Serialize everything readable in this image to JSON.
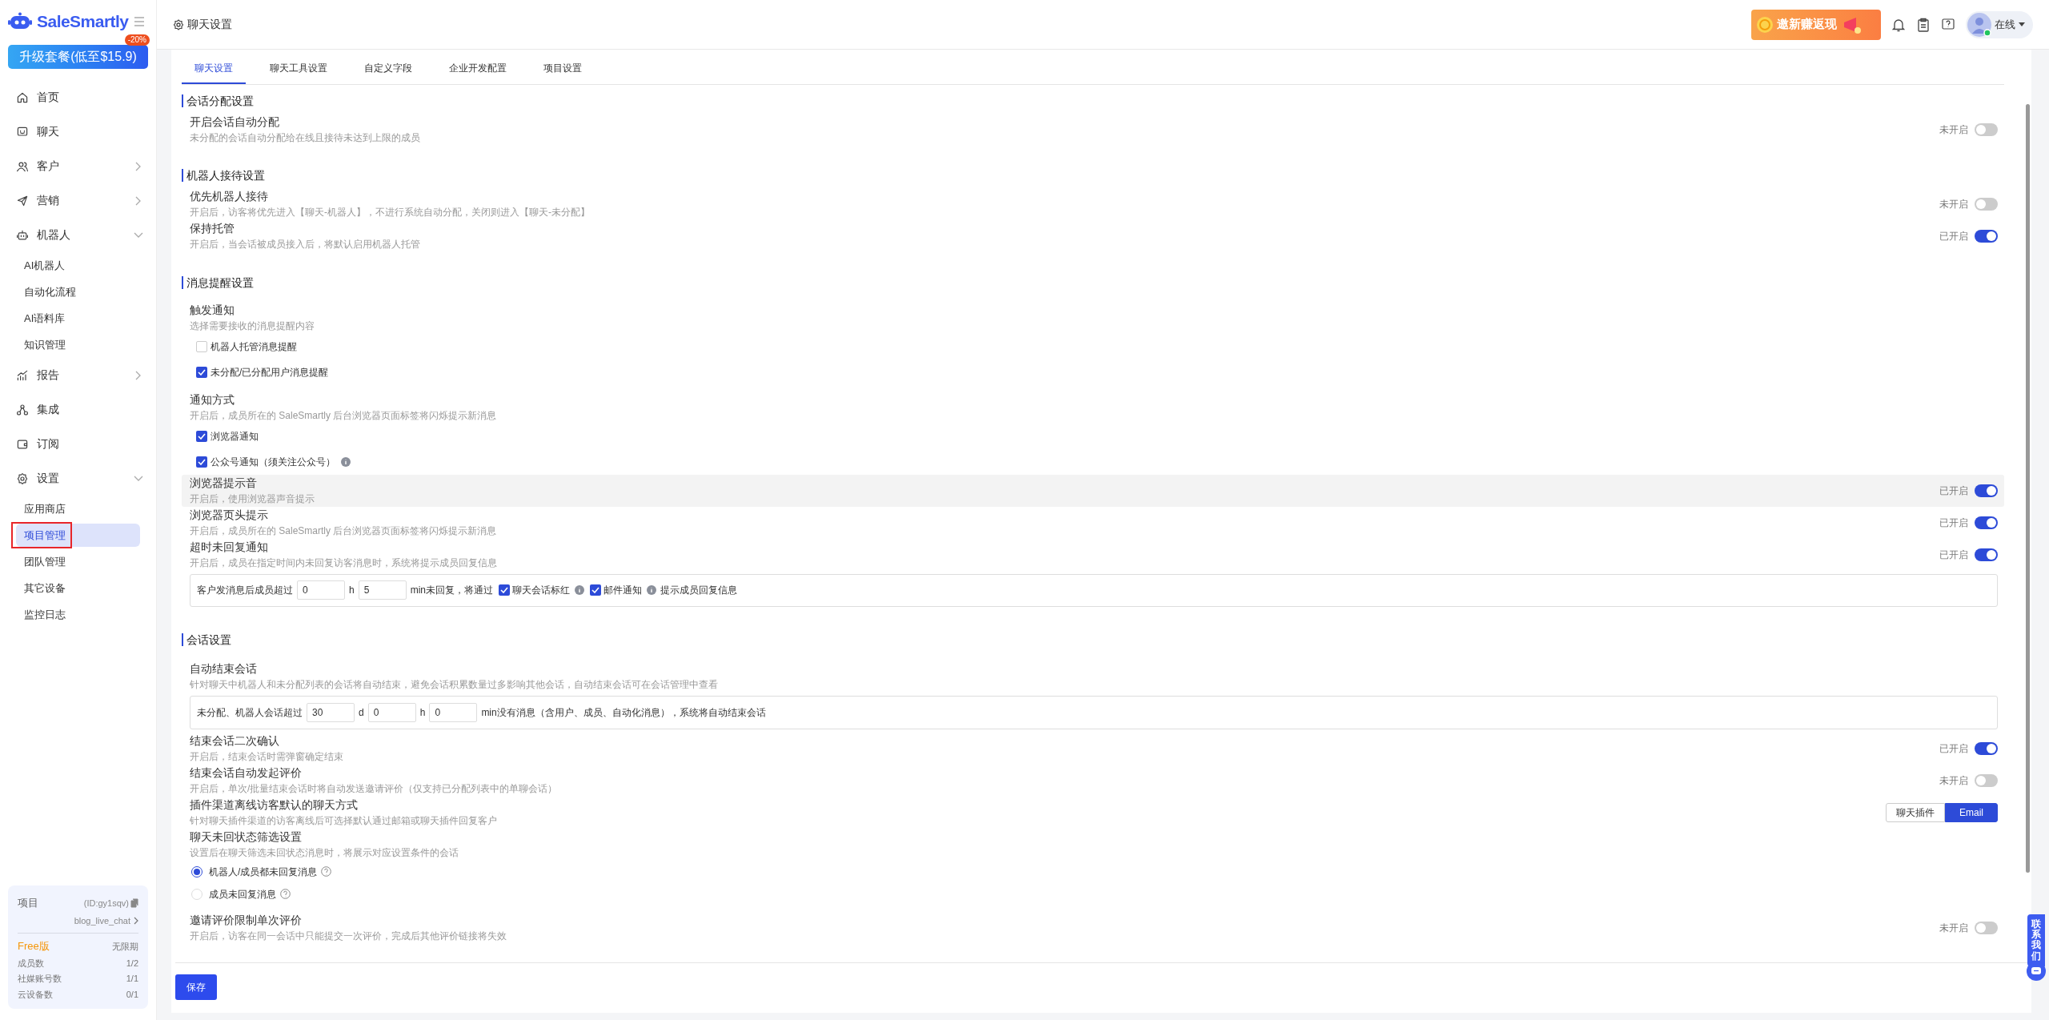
{
  "sidebar": {
    "logo": "SaleSmartly",
    "upgrade": {
      "label": "升级套餐(低至$15.9)",
      "badge": "-20%"
    },
    "items": [
      {
        "label": "首页"
      },
      {
        "label": "聊天"
      },
      {
        "label": "客户",
        "expanded": false
      },
      {
        "label": "营销",
        "expanded": false
      },
      {
        "label": "机器人",
        "expanded": true,
        "children": [
          {
            "label": "AI机器人",
            "selected": false,
            "annotated": false
          },
          {
            "label": "自动化流程",
            "selected": false,
            "annotated": false
          },
          {
            "label": "AI语料库",
            "selected": false,
            "annotated": false
          },
          {
            "label": "知识管理",
            "selected": false,
            "annotated": false
          }
        ]
      },
      {
        "label": "报告",
        "expanded": false
      },
      {
        "label": "集成"
      },
      {
        "label": "订阅"
      },
      {
        "label": "设置",
        "expanded": true,
        "children": [
          {
            "label": "应用商店",
            "selected": false,
            "annotated": false
          },
          {
            "label": "项目管理",
            "selected": true,
            "annotated": true
          },
          {
            "label": "团队管理",
            "selected": false,
            "annotated": false
          },
          {
            "label": "其它设备",
            "selected": false,
            "annotated": false
          },
          {
            "label": "监控日志",
            "selected": false,
            "annotated": false
          }
        ]
      }
    ],
    "project": {
      "label": "项目",
      "id": "(ID:gy1sqv)",
      "name": "blog_live_chat",
      "plan": "Free版",
      "term": "无限期",
      "stats": [
        {
          "label": "成员数",
          "value": "1/2"
        },
        {
          "label": "社媒账号数",
          "value": "1/1"
        },
        {
          "label": "云设备数",
          "value": "0/1"
        }
      ]
    }
  },
  "header": {
    "title": "聊天设置",
    "promo": "邀新赚返现",
    "status": "在线"
  },
  "tabs": [
    {
      "label": "聊天设置",
      "selected": true
    },
    {
      "label": "聊天工具设置",
      "selected": false
    },
    {
      "label": "自定义字段",
      "selected": false
    },
    {
      "label": "企业开发配置",
      "selected": false
    },
    {
      "label": "项目设置",
      "selected": false
    }
  ],
  "sections": [
    {
      "title": "会话分配设置",
      "settings": [
        {
          "kind": "toggle",
          "title": "开启会话自动分配",
          "desc": "未分配的会话自动分配给在线且接待未达到上限的成员",
          "on": false,
          "state_label": "未开启",
          "highlighted": false
        }
      ]
    },
    {
      "title": "机器人接待设置",
      "settings": [
        {
          "kind": "toggle",
          "title": "优先机器人接待",
          "desc": "开启后，访客将优先进入【聊天-机器人】，不进行系统自动分配，关闭则进入【聊天-未分配】",
          "on": false,
          "state_label": "未开启",
          "highlighted": false
        },
        {
          "kind": "toggle",
          "title": "保持托管",
          "desc": "开启后，当会话被成员接入后，将默认启用机器人托管",
          "on": true,
          "state_label": "已开启",
          "highlighted": false
        }
      ]
    },
    {
      "title": "消息提醒设置",
      "settings": [
        {
          "kind": "checks",
          "title": "触发通知",
          "desc": "选择需要接收的消息提醒内容",
          "options": [
            {
              "label": "机器人托管消息提醒",
              "checked": false,
              "info": false
            },
            {
              "label": "未分配/已分配用户消息提醒",
              "checked": true,
              "info": false
            }
          ]
        },
        {
          "kind": "checks",
          "title": "通知方式",
          "desc": "开启后，成员所在的 SaleSmartly 后台浏览器页面标签将闪烁提示新消息",
          "options": [
            {
              "label": "浏览器通知",
              "checked": true,
              "info": false
            },
            {
              "label": "公众号通知（须关注公众号）",
              "checked": true,
              "info": true
            }
          ]
        },
        {
          "kind": "toggle",
          "title": "浏览器提示音",
          "desc": "开启后，使用浏览器声音提示",
          "on": true,
          "state_label": "已开启",
          "highlighted": true
        },
        {
          "kind": "toggle",
          "title": "浏览器页头提示",
          "desc": "开启后，成员所在的 SaleSmartly 后台浏览器页面标签将闪烁提示新消息",
          "on": true,
          "state_label": "已开启",
          "highlighted": false
        },
        {
          "kind": "toggle",
          "title": "超时未回复通知",
          "desc": "开启后，成员在指定时间内未回复访客消息时，系统将提示成员回复信息",
          "on": true,
          "state_label": "已开启",
          "highlighted": false
        },
        {
          "kind": "form",
          "parts": [
            {
              "kind": "text",
              "text": "客户发消息后成员超过"
            },
            {
              "kind": "input",
              "value": "0"
            },
            {
              "kind": "text",
              "text": "h"
            },
            {
              "kind": "input",
              "value": "5"
            },
            {
              "kind": "text",
              "text": "min未回复，将通过"
            },
            {
              "kind": "check",
              "label": "聊天会话标红",
              "checked": true,
              "info": true
            },
            {
              "kind": "check",
              "label": "邮件通知",
              "checked": true,
              "info": true
            },
            {
              "kind": "text",
              "text": "提示成员回复信息"
            }
          ]
        }
      ]
    },
    {
      "title": "会话设置",
      "settings": [
        {
          "kind": "plain",
          "title": "自动结束会话",
          "desc": "针对聊天中机器人和未分配列表的会话将自动结束，避免会话积累数量过多影响其他会话，自动结束会话可在会话管理中查看"
        },
        {
          "kind": "form",
          "parts": [
            {
              "kind": "text",
              "text": "未分配、机器人会话超过"
            },
            {
              "kind": "input",
              "value": "30"
            },
            {
              "kind": "text",
              "text": "d"
            },
            {
              "kind": "input",
              "value": "0"
            },
            {
              "kind": "text",
              "text": "h"
            },
            {
              "kind": "input",
              "value": "0"
            },
            {
              "kind": "text",
              "text": "min没有消息（含用户、成员、自动化消息），系统将自动结束会话"
            }
          ]
        },
        {
          "kind": "toggle",
          "title": "结束会话二次确认",
          "desc": "开启后，结束会话时需弹窗确定结束",
          "on": true,
          "state_label": "已开启",
          "highlighted": false
        },
        {
          "kind": "toggle",
          "title": "结束会话自动发起评价",
          "desc": "开启后，单次/批量结束会话时将自动发送邀请评价（仅支持已分配列表中的单聊会话）",
          "on": false,
          "state_label": "未开启",
          "highlighted": false
        },
        {
          "kind": "segment",
          "title": "插件渠道离线访客默认的聊天方式",
          "desc": "针对聊天插件渠道的访客离线后可选择默认通过邮箱或聊天插件回复客户",
          "options": [
            {
              "label": "聊天插件",
              "selected": false
            },
            {
              "label": "Email",
              "selected": true
            }
          ]
        },
        {
          "kind": "radios",
          "title": "聊天未回状态筛选设置",
          "desc": "设置后在聊天筛选未回状态消息时，将展示对应设置条件的会话",
          "options": [
            {
              "label": "机器人/成员都未回复消息",
              "selected": true,
              "help": true
            },
            {
              "label": "成员未回复消息",
              "selected": false,
              "help": true
            }
          ]
        },
        {
          "kind": "toggle",
          "title": "邀请评价限制单次评价",
          "desc": "开启后，访客在同一会话中只能提交一次评价，完成后其他评价链接将失效",
          "on": false,
          "state_label": "未开启",
          "highlighted": false
        }
      ]
    }
  ],
  "save": "保存",
  "contact": "联系我们"
}
